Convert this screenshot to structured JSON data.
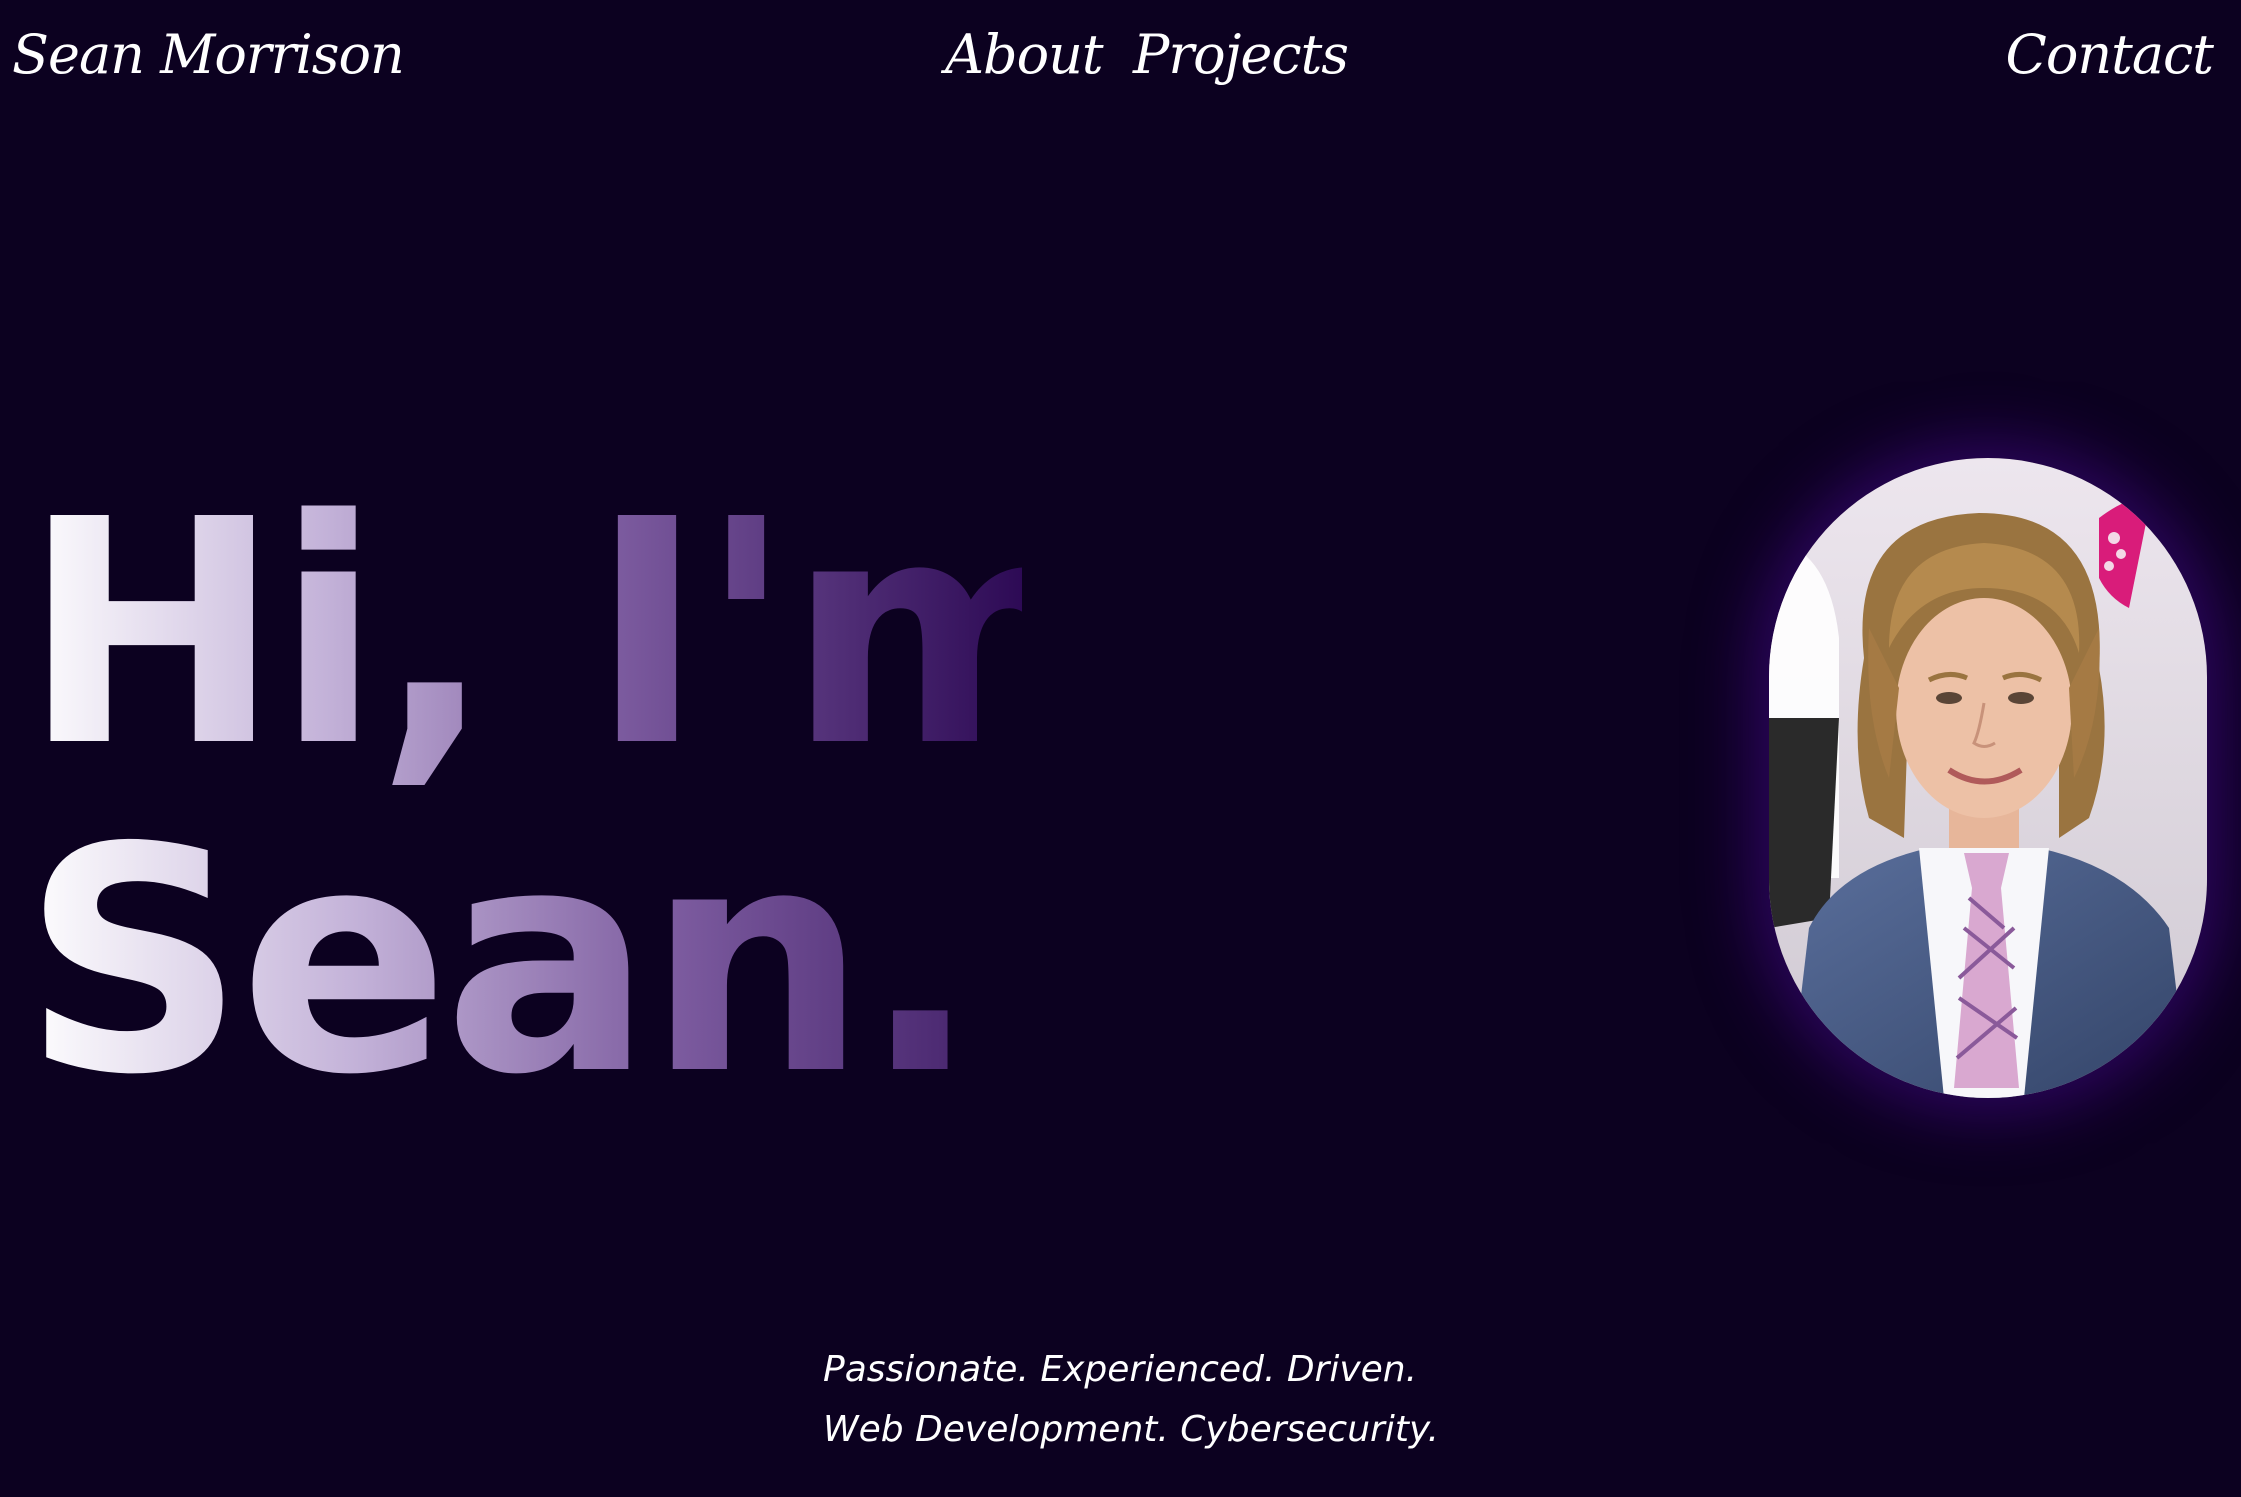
{
  "nav": {
    "brand": "Sean Morrison",
    "about": "About",
    "projects": "Projects",
    "contact": "Contact"
  },
  "hero": {
    "line1": "Hi, I'm",
    "line2": "Sean."
  },
  "portrait": {
    "alt": "Portrait photo of Sean Morrison"
  },
  "tagline": {
    "line1": "Passionate. Experienced. Driven.",
    "line2": "Web Development. Cybersecurity."
  },
  "colors": {
    "background": "#0c0120",
    "accent_glow": "#46108c",
    "gradient_start": "#ffffff",
    "gradient_end": "#2d0a55"
  }
}
